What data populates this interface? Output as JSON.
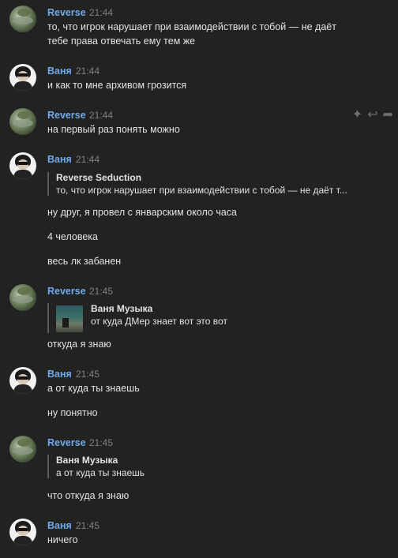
{
  "messages": [
    {
      "author": "Reverse",
      "time": "21:44",
      "lines": [
        "то, что игрок нарушает при взаимодействии с тобой — не даёт",
        "тебе права отвечать ему тем же"
      ]
    },
    {
      "author": "Ваня",
      "time": "21:44",
      "lines": [
        "и как то мне архивом грозится"
      ]
    },
    {
      "author": "Reverse",
      "time": "21:44",
      "lines": [
        "на первый раз понять можно"
      ]
    },
    {
      "author": "Ваня",
      "time": "21:44",
      "reply": {
        "name": "Reverse Seduction",
        "text": "то, что игрок нарушает при взаимодействии с тобой — не даёт т..."
      },
      "lines": [
        "ну друг, я провел с январским около часа",
        "4 человека",
        "весь лк забанен"
      ]
    },
    {
      "author": "Reverse",
      "time": "21:45",
      "reply": {
        "name": "Ваня Музыка",
        "text": "от куда ДМер знает вот это вот"
      },
      "lines": [
        "откуда я знаю"
      ]
    },
    {
      "author": "Ваня",
      "time": "21:45",
      "lines": [
        "а от куда ты знаешь",
        "ну понятно"
      ]
    },
    {
      "author": "Reverse",
      "time": "21:45",
      "reply": {
        "name": "Ваня Музыка",
        "text": "а от куда ты знаешь"
      },
      "lines": [
        "что откуда я знаю"
      ]
    },
    {
      "author": "Ваня",
      "time": "21:45",
      "lines": [
        "ничего"
      ]
    }
  ],
  "actions": {
    "sparkle_icon": "✦",
    "reply_icon": "↩",
    "forward_icon": "➦"
  }
}
